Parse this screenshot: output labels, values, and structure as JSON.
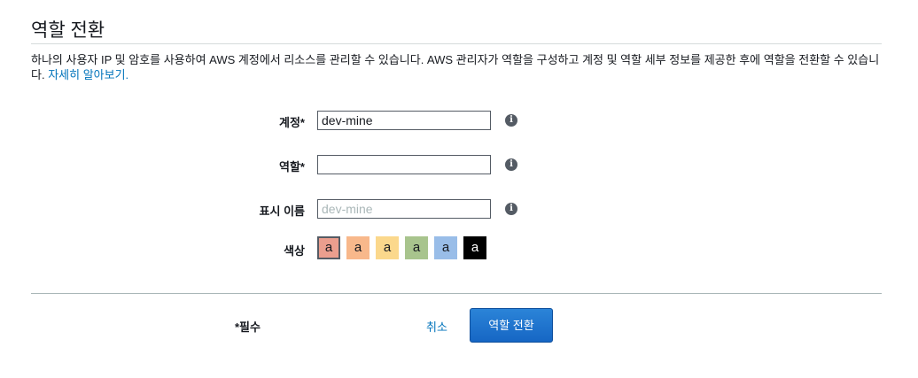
{
  "header": {
    "title": "역할 전환"
  },
  "description": {
    "text": "하나의 사용자 IP 및 암호를 사용하여 AWS 계정에서 리소스를 관리할 수 있습니다. AWS 관리자가 역할을 구성하고 계정 및 역할 세부 정보를 제공한 후에 역할을 전환할 수 있습니다.",
    "learn_more": "자세히 알아보기."
  },
  "form": {
    "account": {
      "label": "계정*",
      "value": "dev-mine",
      "placeholder": ""
    },
    "role": {
      "label": "역할*",
      "value": "",
      "placeholder": ""
    },
    "display_name": {
      "label": "표시 이름",
      "value": "",
      "placeholder": "dev-mine"
    },
    "color": {
      "label": "색상",
      "swatch_text": "a",
      "options": [
        {
          "hex": "#eb9e8e",
          "selected": true
        },
        {
          "hex": "#f8b88b",
          "selected": false
        },
        {
          "hex": "#fbd88c",
          "selected": false
        },
        {
          "hex": "#a8c48d",
          "selected": false
        },
        {
          "hex": "#99bde8",
          "selected": false
        },
        {
          "hex": "#000000",
          "selected": false
        }
      ]
    },
    "info_icon": "info-icon"
  },
  "footer": {
    "required_note": "*필수",
    "cancel_label": "취소",
    "submit_label": "역할 전환"
  },
  "colors": {
    "link": "#0073bb",
    "primary_button": "#1a73e8",
    "text": "#16191f"
  }
}
